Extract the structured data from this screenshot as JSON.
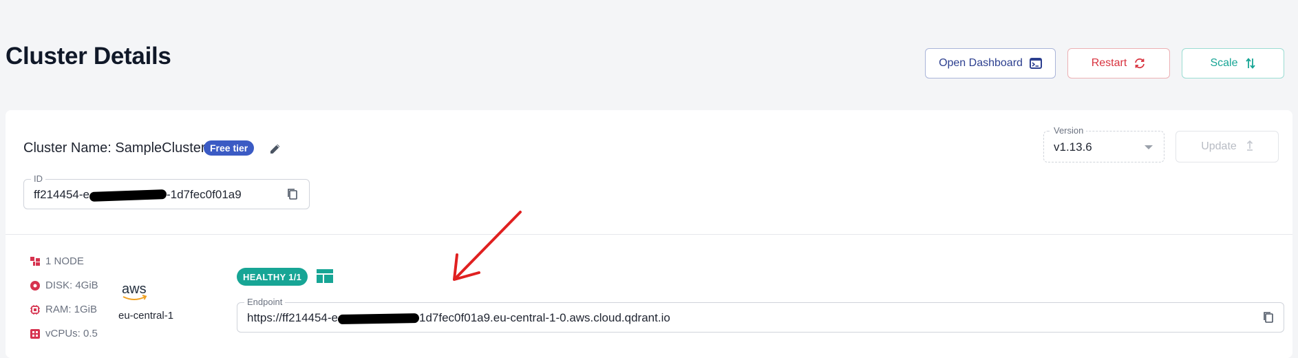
{
  "header": {
    "title": "Cluster Details",
    "buttons": {
      "open_dashboard": "Open Dashboard",
      "restart": "Restart",
      "scale": "Scale"
    }
  },
  "cluster": {
    "name_label": "Cluster Name: SampleCluster",
    "tier_badge": "Free tier",
    "id_legend": "ID",
    "id_value_start": "ff214454-e",
    "id_value_end": "-1d7fec0f01a9",
    "version_legend": "Version",
    "version_value": "v1.13.6",
    "update_label": "Update"
  },
  "specs": {
    "nodes": "1 NODE",
    "disk": "DISK: 4GiB",
    "ram": "RAM: 1GiB",
    "vcpus": "vCPUs: 0.5"
  },
  "provider": {
    "logo_text": "aws",
    "region": "eu-central-1"
  },
  "status": {
    "health_badge": "HEALTHY 1/1"
  },
  "endpoint": {
    "legend": "Endpoint",
    "value_start": "https://ff214454-e",
    "value_end": "1d7fec0f01a9.eu-central-1-0.aws.cloud.qdrant.io"
  },
  "colors": {
    "primary": "#2c3f8f",
    "danger": "#d8323e",
    "success": "#17a595",
    "badge_blue": "#3b5bc4",
    "spec_icon": "#d6334f",
    "annotation_arrow": "#e02020"
  },
  "icons": {
    "open_dashboard": "terminal-icon",
    "restart": "refresh-icon",
    "scale": "swap-vertical-icon",
    "edit": "pencil-icon",
    "copy": "copy-icon",
    "update": "upload-icon",
    "nodes": "nodes-icon",
    "disk": "disk-icon",
    "ram": "chip-icon",
    "vcpus": "cpu-icon",
    "layout": "table-layout-icon"
  }
}
